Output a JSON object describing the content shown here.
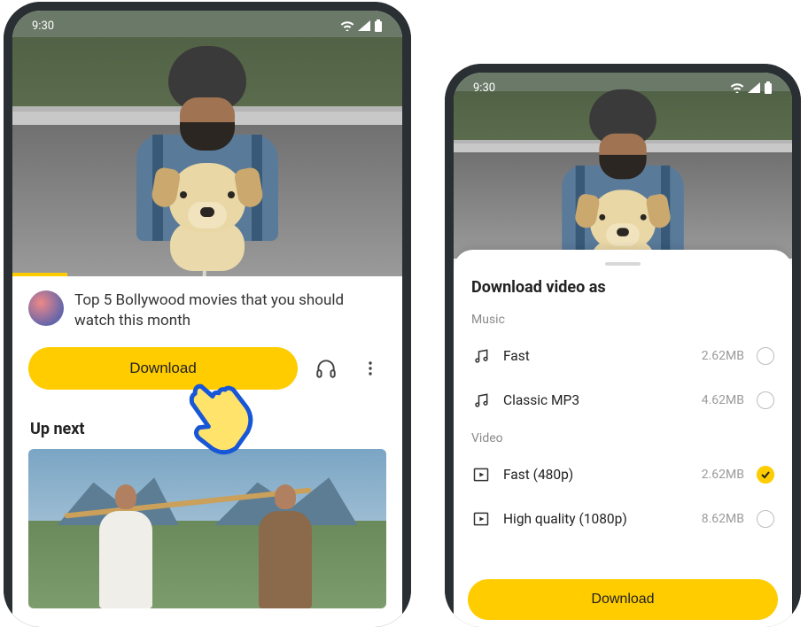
{
  "status": {
    "time": "9:30"
  },
  "left": {
    "video_title": "Top 5 Bollywood movies that you should watch this month",
    "download_label": "Download",
    "up_next_label": "Up next"
  },
  "sheet": {
    "title": "Download video as",
    "music_label": "Music",
    "video_label": "Video",
    "download_label": "Download",
    "music_options": [
      {
        "label": "Fast",
        "size": "2.62MB",
        "selected": false
      },
      {
        "label": "Classic MP3",
        "size": "4.62MB",
        "selected": false
      }
    ],
    "video_options": [
      {
        "label": "Fast (480p)",
        "size": "2.62MB",
        "selected": true
      },
      {
        "label": "High quality (1080p)",
        "size": "8.62MB",
        "selected": false
      }
    ]
  }
}
